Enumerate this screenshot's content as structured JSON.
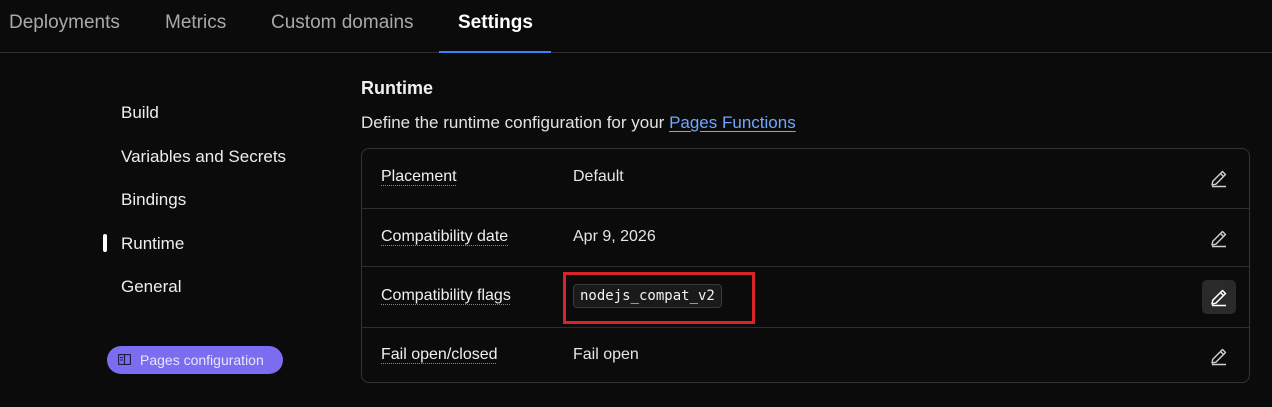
{
  "tabs": [
    {
      "label": "Deployments",
      "active": false
    },
    {
      "label": "Metrics",
      "active": false
    },
    {
      "label": "Custom domains",
      "active": false
    },
    {
      "label": "Settings",
      "active": true
    }
  ],
  "sidenav": {
    "items": [
      {
        "label": "Build",
        "active": false
      },
      {
        "label": "Variables and Secrets",
        "active": false
      },
      {
        "label": "Bindings",
        "active": false
      },
      {
        "label": "Runtime",
        "active": true
      },
      {
        "label": "General",
        "active": false
      }
    ],
    "pages_config_button": {
      "label": "Pages configuration",
      "icon": "book-icon"
    }
  },
  "runtime": {
    "title": "Runtime",
    "description_prefix": "Define the runtime configuration for your ",
    "description_link": "Pages Functions",
    "rows": [
      {
        "label": "Placement",
        "value": "Default",
        "edit_icon": "pencil-icon"
      },
      {
        "label": "Compatibility date",
        "value": "Apr 9, 2026",
        "edit_icon": "pencil-icon"
      },
      {
        "label": "Compatibility flags",
        "value": "nodejs_compat_v2",
        "edit_icon": "pencil-icon",
        "highlighted": true
      },
      {
        "label": "Fail open/closed",
        "value": "Fail open",
        "edit_icon": "pencil-icon"
      }
    ]
  },
  "colors": {
    "background": "#0b0b0b",
    "accent_tab": "#3b82f6",
    "link": "#6ea8ff",
    "pages_config_bg": "#7c6cf0",
    "highlight_border": "#d8232a"
  }
}
